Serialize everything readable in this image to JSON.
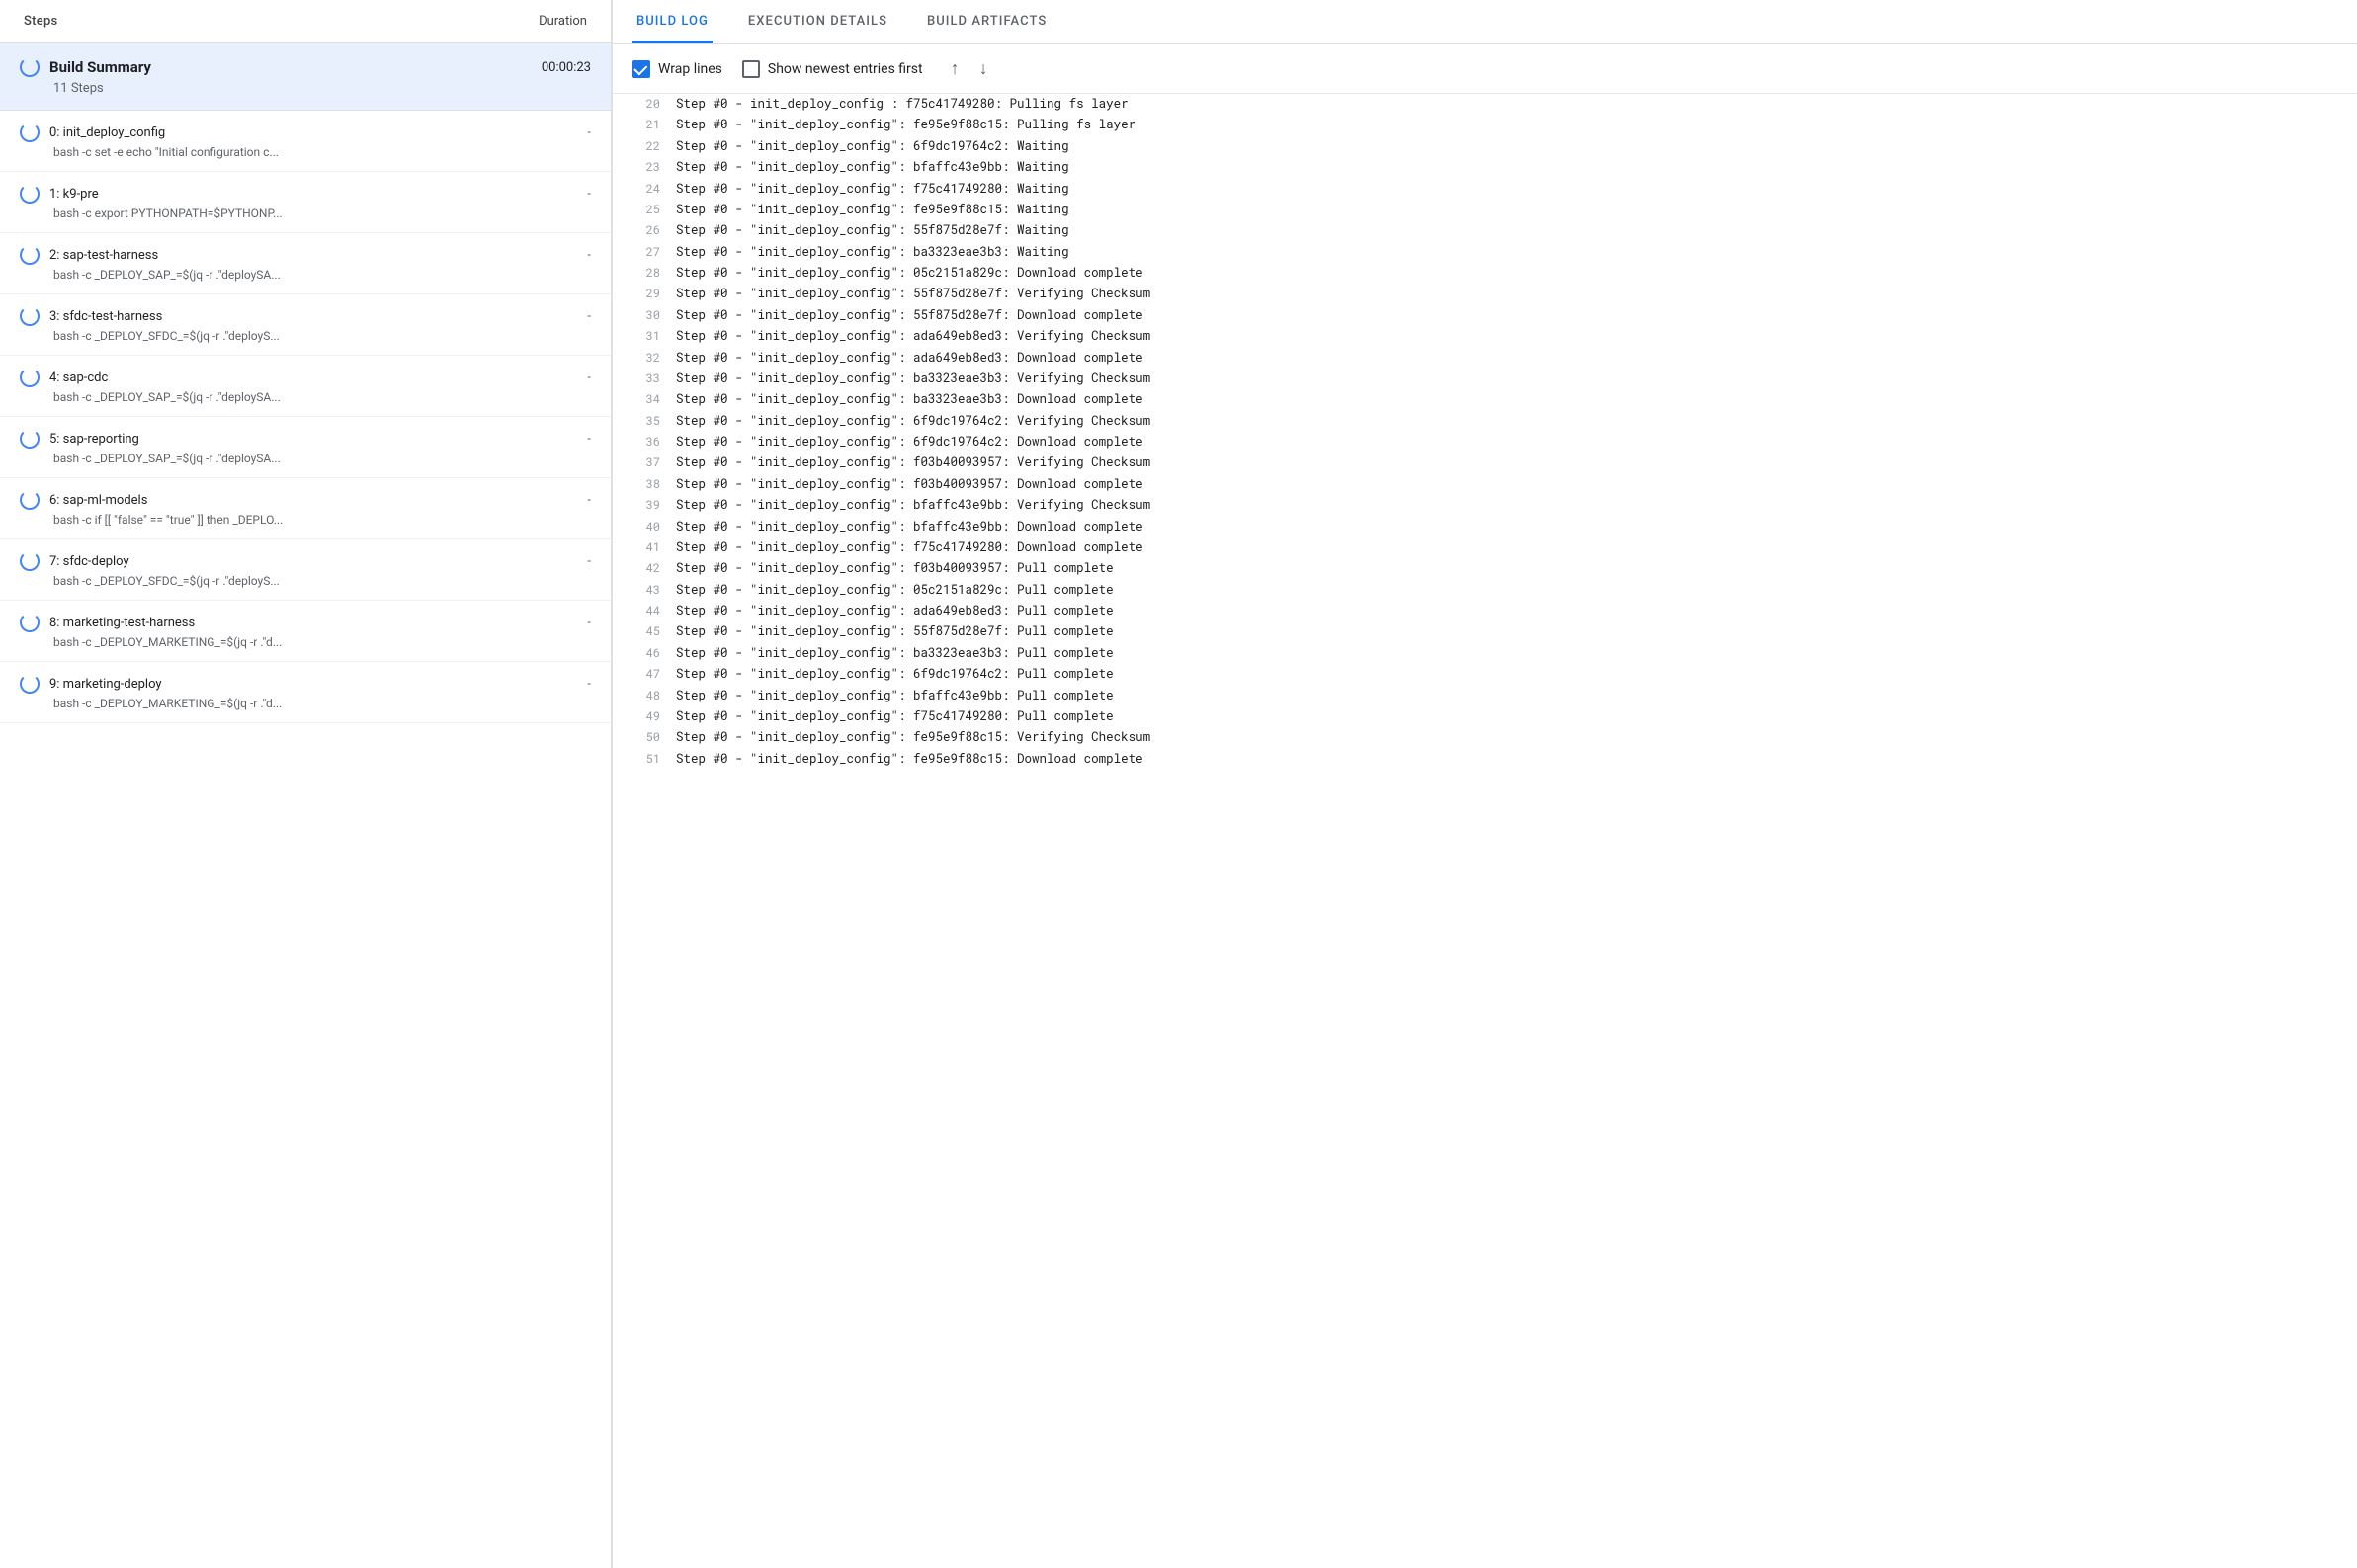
{
  "left": {
    "header": {
      "steps_label": "Steps",
      "duration_label": "Duration"
    },
    "build_summary": {
      "title": "Build Summary",
      "steps_count": "11 Steps",
      "duration": "00:00:23"
    },
    "steps": [
      {
        "index": "0",
        "name": "init_deploy_config",
        "cmd": "bash -c set -e echo \"Initial configuration c...",
        "duration": "-"
      },
      {
        "index": "1",
        "name": "k9-pre",
        "cmd": "bash -c export PYTHONPATH=$PYTHONP...",
        "duration": "-"
      },
      {
        "index": "2",
        "name": "sap-test-harness",
        "cmd": "bash -c _DEPLOY_SAP_=$(jq -r .\"deploySA...",
        "duration": "-"
      },
      {
        "index": "3",
        "name": "sfdc-test-harness",
        "cmd": "bash -c _DEPLOY_SFDC_=$(jq -r .\"deployS...",
        "duration": "-"
      },
      {
        "index": "4",
        "name": "sap-cdc",
        "cmd": "bash -c _DEPLOY_SAP_=$(jq -r .\"deploySA...",
        "duration": "-"
      },
      {
        "index": "5",
        "name": "sap-reporting",
        "cmd": "bash -c _DEPLOY_SAP_=$(jq -r .\"deploySA...",
        "duration": "-"
      },
      {
        "index": "6",
        "name": "sap-ml-models",
        "cmd": "bash -c if [[ \"false\" == \"true\" ]] then _DEPLO...",
        "duration": "-"
      },
      {
        "index": "7",
        "name": "sfdc-deploy",
        "cmd": "bash -c _DEPLOY_SFDC_=$(jq -r .\"deployS...",
        "duration": "-"
      },
      {
        "index": "8",
        "name": "marketing-test-harness",
        "cmd": "bash -c _DEPLOY_MARKETING_=$(jq -r .\"d...",
        "duration": "-"
      },
      {
        "index": "9",
        "name": "marketing-deploy",
        "cmd": "bash -c _DEPLOY_MARKETING_=$(jq -r .\"d...",
        "duration": "-"
      }
    ]
  },
  "right": {
    "tabs": [
      {
        "id": "build-log",
        "label": "BUILD LOG",
        "active": true
      },
      {
        "id": "execution-details",
        "label": "EXECUTION DETAILS",
        "active": false
      },
      {
        "id": "build-artifacts",
        "label": "BUILD ARTIFACTS",
        "active": false
      }
    ],
    "toolbar": {
      "wrap_lines_label": "Wrap lines",
      "newest_entries_label": "Show newest entries first",
      "scroll_top_icon": "↑",
      "scroll_bottom_icon": "↓"
    },
    "log_lines": [
      {
        "num": "20",
        "text": "Step #0 -  init_deploy_config : f75c41749280: Pulling fs layer"
      },
      {
        "num": "21",
        "text": "Step #0 - \"init_deploy_config\": fe95e9f88c15: Pulling fs layer"
      },
      {
        "num": "22",
        "text": "Step #0 - \"init_deploy_config\": 6f9dc19764c2: Waiting"
      },
      {
        "num": "23",
        "text": "Step #0 - \"init_deploy_config\": bfaffc43e9bb: Waiting"
      },
      {
        "num": "24",
        "text": "Step #0 - \"init_deploy_config\": f75c41749280: Waiting"
      },
      {
        "num": "25",
        "text": "Step #0 - \"init_deploy_config\": fe95e9f88c15: Waiting"
      },
      {
        "num": "26",
        "text": "Step #0 - \"init_deploy_config\": 55f875d28e7f: Waiting"
      },
      {
        "num": "27",
        "text": "Step #0 - \"init_deploy_config\": ba3323eae3b3: Waiting"
      },
      {
        "num": "28",
        "text": "Step #0 - \"init_deploy_config\": 05c2151a829c: Download complete"
      },
      {
        "num": "29",
        "text": "Step #0 - \"init_deploy_config\": 55f875d28e7f: Verifying Checksum"
      },
      {
        "num": "30",
        "text": "Step #0 - \"init_deploy_config\": 55f875d28e7f: Download complete"
      },
      {
        "num": "31",
        "text": "Step #0 - \"init_deploy_config\": ada649eb8ed3: Verifying Checksum"
      },
      {
        "num": "32",
        "text": "Step #0 - \"init_deploy_config\": ada649eb8ed3: Download complete"
      },
      {
        "num": "33",
        "text": "Step #0 - \"init_deploy_config\": ba3323eae3b3: Verifying Checksum"
      },
      {
        "num": "34",
        "text": "Step #0 - \"init_deploy_config\": ba3323eae3b3: Download complete"
      },
      {
        "num": "35",
        "text": "Step #0 - \"init_deploy_config\": 6f9dc19764c2: Verifying Checksum"
      },
      {
        "num": "36",
        "text": "Step #0 - \"init_deploy_config\": 6f9dc19764c2: Download complete"
      },
      {
        "num": "37",
        "text": "Step #0 - \"init_deploy_config\": f03b40093957: Verifying Checksum"
      },
      {
        "num": "38",
        "text": "Step #0 - \"init_deploy_config\": f03b40093957: Download complete"
      },
      {
        "num": "39",
        "text": "Step #0 - \"init_deploy_config\": bfaffc43e9bb: Verifying Checksum"
      },
      {
        "num": "40",
        "text": "Step #0 - \"init_deploy_config\": bfaffc43e9bb: Download complete"
      },
      {
        "num": "41",
        "text": "Step #0 - \"init_deploy_config\": f75c41749280: Download complete"
      },
      {
        "num": "42",
        "text": "Step #0 - \"init_deploy_config\": f03b40093957: Pull complete"
      },
      {
        "num": "43",
        "text": "Step #0 - \"init_deploy_config\": 05c2151a829c: Pull complete"
      },
      {
        "num": "44",
        "text": "Step #0 - \"init_deploy_config\": ada649eb8ed3: Pull complete"
      },
      {
        "num": "45",
        "text": "Step #0 - \"init_deploy_config\": 55f875d28e7f: Pull complete"
      },
      {
        "num": "46",
        "text": "Step #0 - \"init_deploy_config\": ba3323eae3b3: Pull complete"
      },
      {
        "num": "47",
        "text": "Step #0 - \"init_deploy_config\": 6f9dc19764c2: Pull complete"
      },
      {
        "num": "48",
        "text": "Step #0 - \"init_deploy_config\": bfaffc43e9bb: Pull complete"
      },
      {
        "num": "49",
        "text": "Step #0 - \"init_deploy_config\": f75c41749280: Pull complete"
      },
      {
        "num": "50",
        "text": "Step #0 - \"init_deploy_config\": fe95e9f88c15: Verifying Checksum"
      },
      {
        "num": "51",
        "text": "Step #0 - \"init_deploy_config\": fe95e9f88c15: Download complete"
      }
    ]
  }
}
